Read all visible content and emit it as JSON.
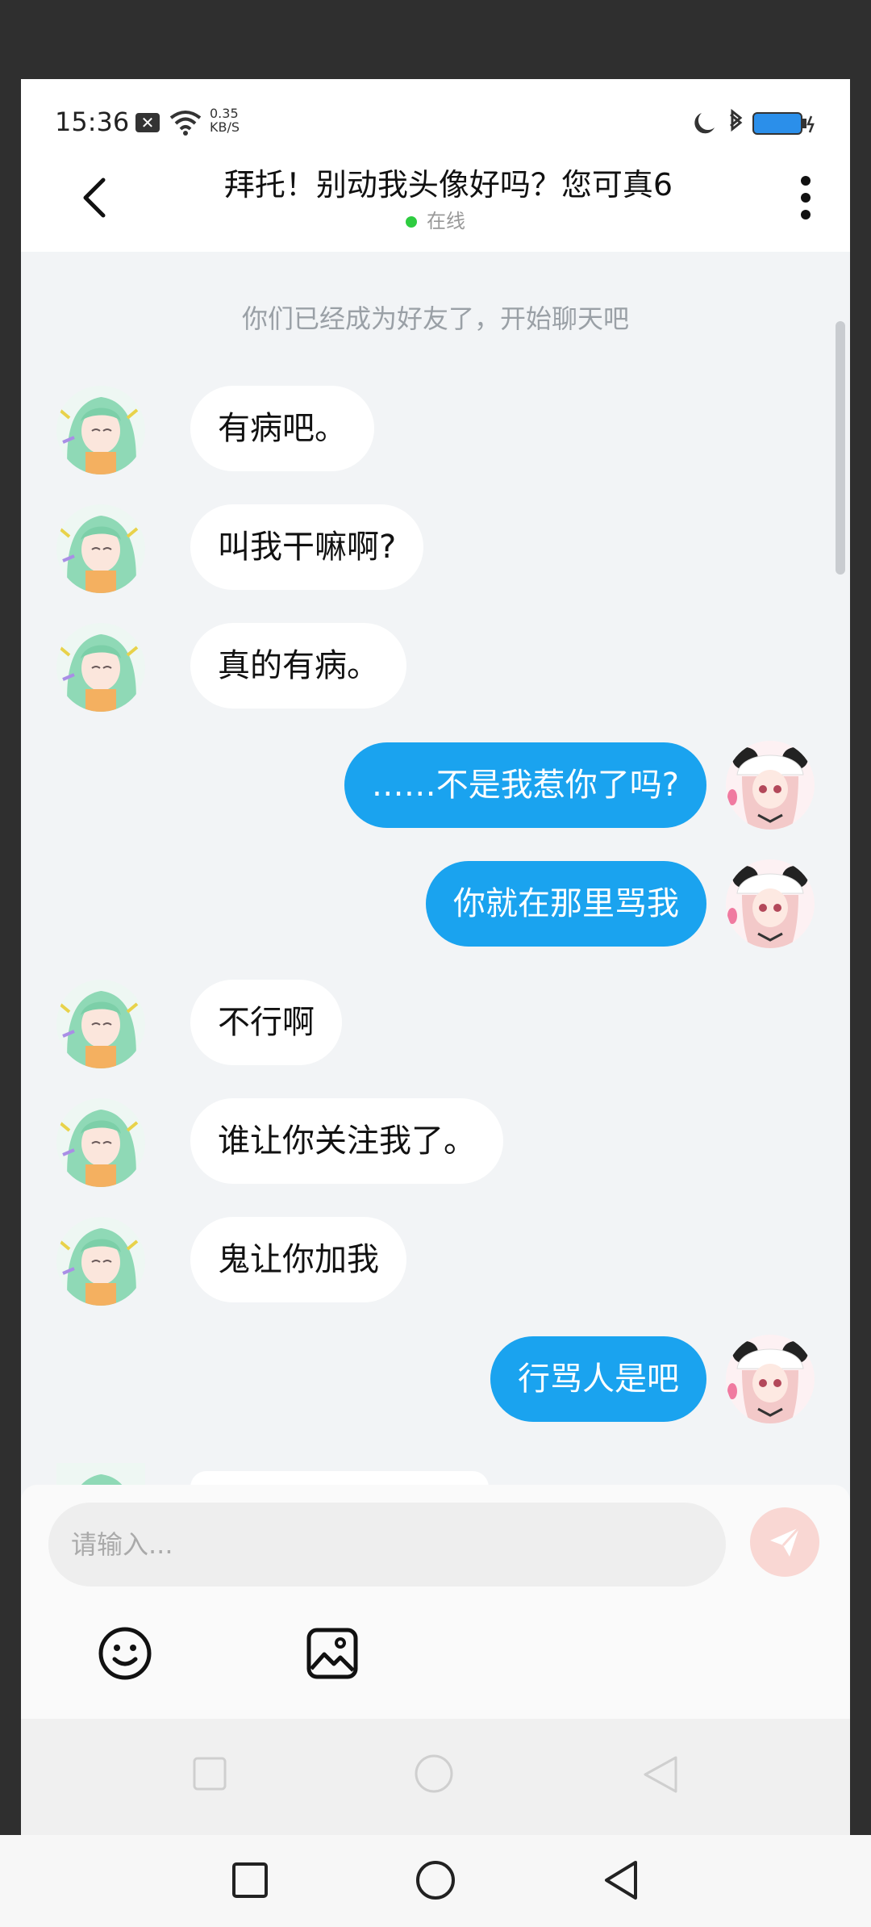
{
  "status_bar": {
    "time": "15:36",
    "speed_value": "0.35",
    "speed_unit": "KB/S"
  },
  "header": {
    "title": "拜托！别动我头像好吗？您可真6",
    "presence": "在线"
  },
  "system_note": "你们已经成为好友了，开始聊天吧",
  "messages": [
    {
      "side": "in",
      "text": "有病吧。"
    },
    {
      "side": "in",
      "text": "叫我干嘛啊?"
    },
    {
      "side": "in",
      "text": "真的有病。"
    },
    {
      "side": "out",
      "text": "……不是我惹你了吗?"
    },
    {
      "side": "out",
      "text": "你就在那里骂我"
    },
    {
      "side": "in",
      "text": "不行啊"
    },
    {
      "side": "in",
      "text": "谁让你关注我了。"
    },
    {
      "side": "in",
      "text": "鬼让你加我"
    },
    {
      "side": "out",
      "text": "行骂人是吧"
    }
  ],
  "composer": {
    "placeholder": "请输入..."
  },
  "icons": {
    "back": "back-arrow-icon",
    "more": "more-vertical-icon",
    "send": "send-icon",
    "emoji": "emoji-icon",
    "image": "image-icon",
    "sys_nav": [
      "square-icon",
      "circle-icon",
      "triangle-back-icon"
    ]
  },
  "colors": {
    "outgoing_bubble": "#1aa3ef",
    "incoming_bubble": "#ffffff",
    "online": "#2ecc40",
    "send_button": "#f9d7d3"
  }
}
